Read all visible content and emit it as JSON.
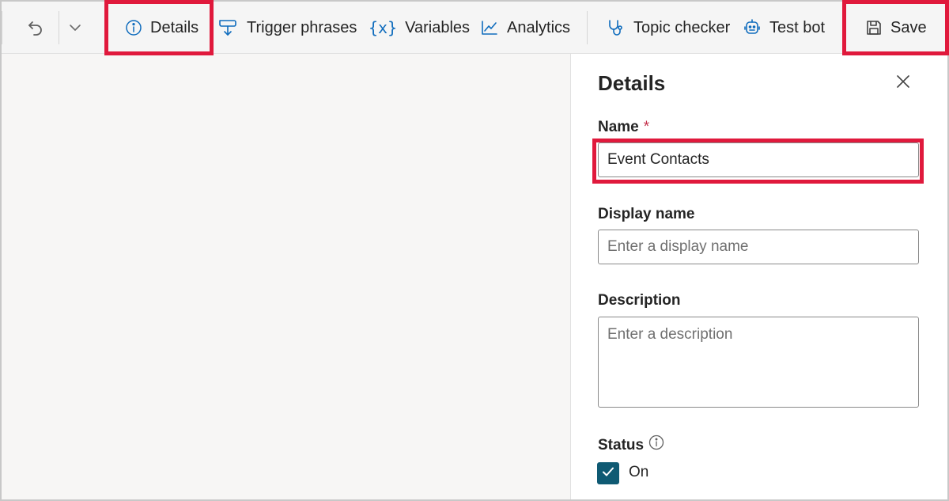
{
  "toolbar": {
    "details_label": "Details",
    "trigger_phrases_label": "Trigger phrases",
    "variables_label": "Variables",
    "analytics_label": "Analytics",
    "topic_checker_label": "Topic checker",
    "test_bot_label": "Test bot",
    "save_label": "Save"
  },
  "panel": {
    "title": "Details",
    "name_label": "Name",
    "required_mark": "*",
    "name_value": "Event Contacts",
    "display_name_label": "Display name",
    "display_name_placeholder": "Enter a display name",
    "description_label": "Description",
    "description_placeholder": "Enter a description",
    "status_label": "Status",
    "status_value": "On"
  },
  "icons": {
    "undo": "undo-icon",
    "dropdown": "chevron-down-icon",
    "details": "info-icon",
    "trigger": "trigger-phrases-icon",
    "variables": "variables-icon",
    "analytics": "analytics-icon",
    "topic_checker": "stethoscope-icon",
    "test_bot": "bot-icon",
    "save": "save-icon",
    "close": "close-icon",
    "status_info": "info-icon",
    "checkbox": "checkmark-icon"
  },
  "colors": {
    "accent": "#0f6cbd",
    "highlight": "#e0193c",
    "checkbox_fill": "#0f5a73"
  }
}
